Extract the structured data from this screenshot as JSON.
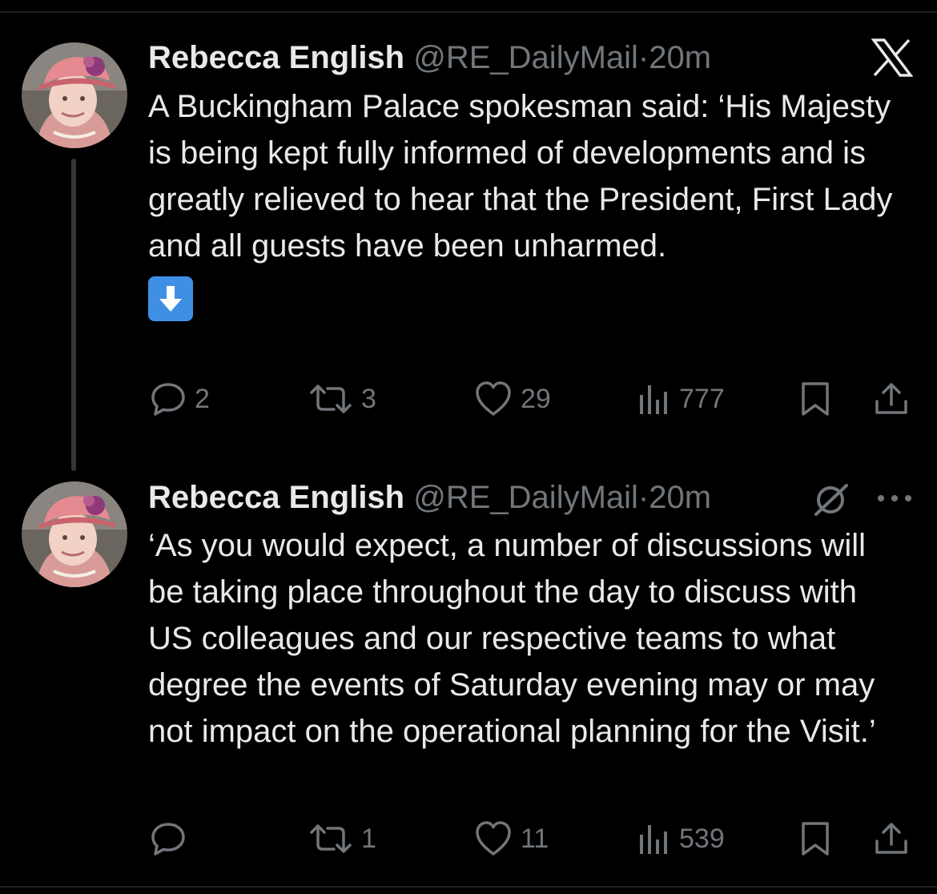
{
  "tweets": [
    {
      "name": "Rebecca English",
      "handle": "@RE_DailyMail",
      "separator": "·",
      "time": "20m",
      "text": "A Buckingham Palace spokesman said: ‘His Majesty is being kept fully informed of developments and is greatly relieved to hear that the President, First Lady and all guests have been unharmed.",
      "emoji": "down-arrow-emoji",
      "replies": "2",
      "retweets": "3",
      "likes": "29",
      "views": "777"
    },
    {
      "name": "Rebecca English",
      "handle": "@RE_DailyMail",
      "separator": "·",
      "time": "20m",
      "text": "‘As you would expect, a number of discussions will be taking place throughout the day to discuss with US colleagues and our respective teams to what degree the events of Saturday evening may or may not impact on the operational planning for the Visit.’",
      "replies": "",
      "retweets": "1",
      "likes": "11",
      "views": "539"
    }
  ],
  "colors": {
    "background": "#000000",
    "text_primary": "#e7e9ea",
    "text_secondary": "#71767b",
    "thread_line": "#333639",
    "emoji_blue": "#3f8fe4"
  },
  "icons": [
    "x-logo-icon",
    "reply-icon",
    "retweet-icon",
    "like-icon",
    "views-icon",
    "bookmark-icon",
    "share-icon",
    "grok-icon",
    "more-icon"
  ]
}
